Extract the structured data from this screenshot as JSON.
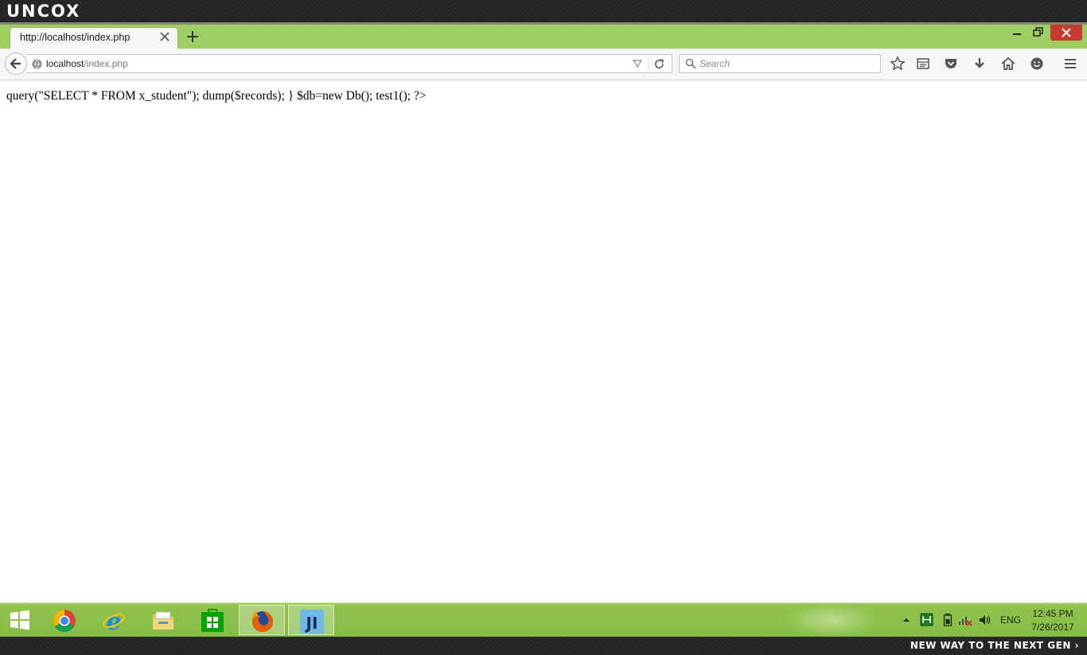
{
  "brand": {
    "logo": "UNCOX",
    "footer_tagline": "NEW WAY TO THE NEXT GEN ›"
  },
  "browser": {
    "tab": {
      "title": "http://localhost/index.php"
    },
    "url": {
      "host": "localhost",
      "path": "/index.php"
    },
    "search": {
      "placeholder": "Search"
    },
    "accent": "#9fcf63"
  },
  "page": {
    "text": "query(\"SELECT * FROM x_student\"); dump($records); } $db=new Db(); test1(); ?>"
  },
  "taskbar": {
    "apps": [
      "start-icon",
      "chrome-icon",
      "internet-explorer-icon",
      "file-explorer-icon",
      "store-icon",
      "firefox-icon",
      "jetbrains-icon"
    ],
    "active_app": "firefox-icon",
    "tray": {
      "language": "ENG",
      "time": "12:45 PM",
      "date": "7/26/2017"
    }
  }
}
